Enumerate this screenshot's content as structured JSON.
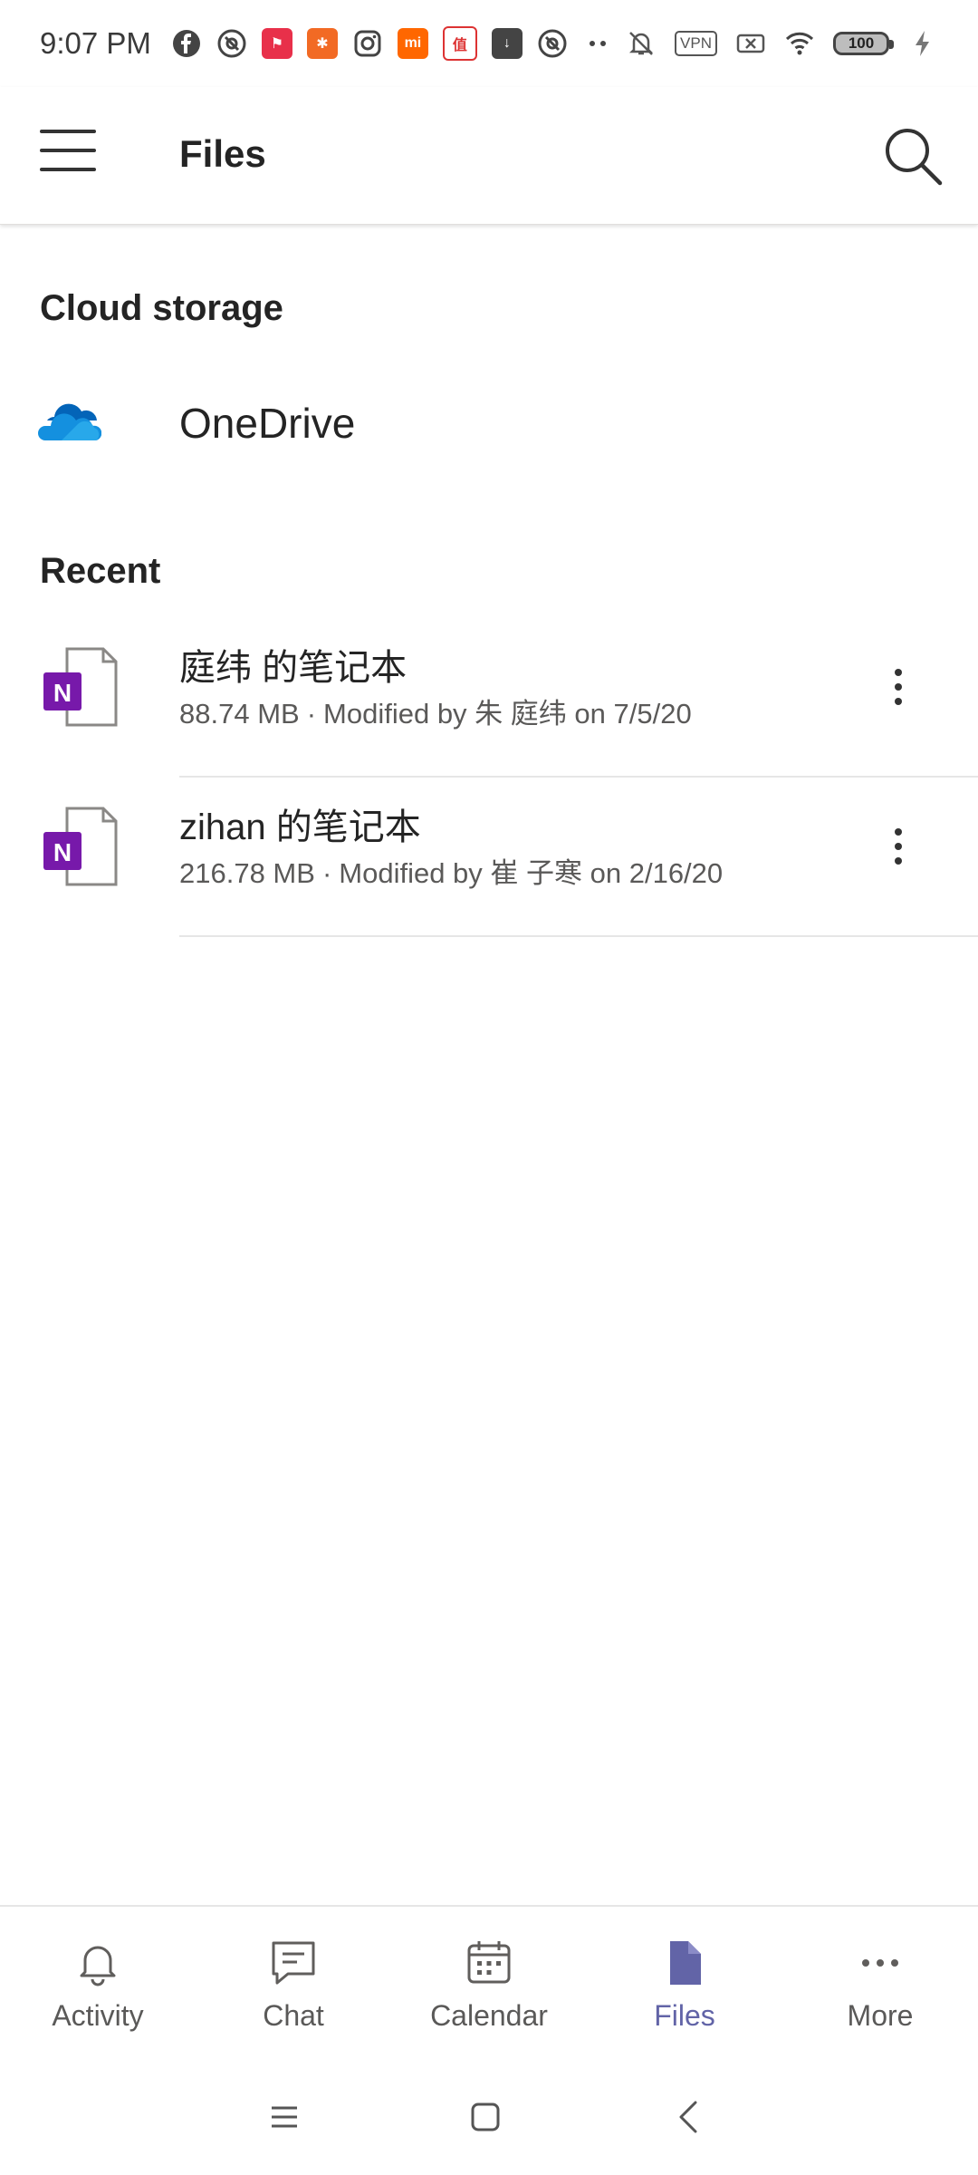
{
  "status_bar": {
    "time": "9:07 PM",
    "vpn": "VPN",
    "battery": "100",
    "mi_label": "mi"
  },
  "app_bar": {
    "title": "Files"
  },
  "cloud_storage": {
    "heading": "Cloud storage",
    "items": [
      {
        "label": "OneDrive",
        "icon": "onedrive-icon"
      }
    ]
  },
  "recent": {
    "heading": "Recent",
    "files": [
      {
        "name": "庭纬 的笔记本",
        "size": "88.74 MB",
        "modified": "Modified by 朱 庭纬 on 7/5/20",
        "icon": "onenote-icon"
      },
      {
        "name": "zihan 的笔记本",
        "size": "216.78 MB",
        "modified": "Modified by 崔 子寒 on 2/16/20",
        "icon": "onenote-icon"
      }
    ]
  },
  "bottom_nav": {
    "items": [
      {
        "label": "Activity",
        "icon": "bell-icon"
      },
      {
        "label": "Chat",
        "icon": "chat-icon"
      },
      {
        "label": "Calendar",
        "icon": "calendar-icon"
      },
      {
        "label": "Files",
        "icon": "file-icon",
        "active": true
      },
      {
        "label": "More",
        "icon": "more-icon"
      }
    ]
  },
  "colors": {
    "accent": "#6264a7",
    "onenote": "#7719aa",
    "onedrive": "#0f78d4"
  }
}
